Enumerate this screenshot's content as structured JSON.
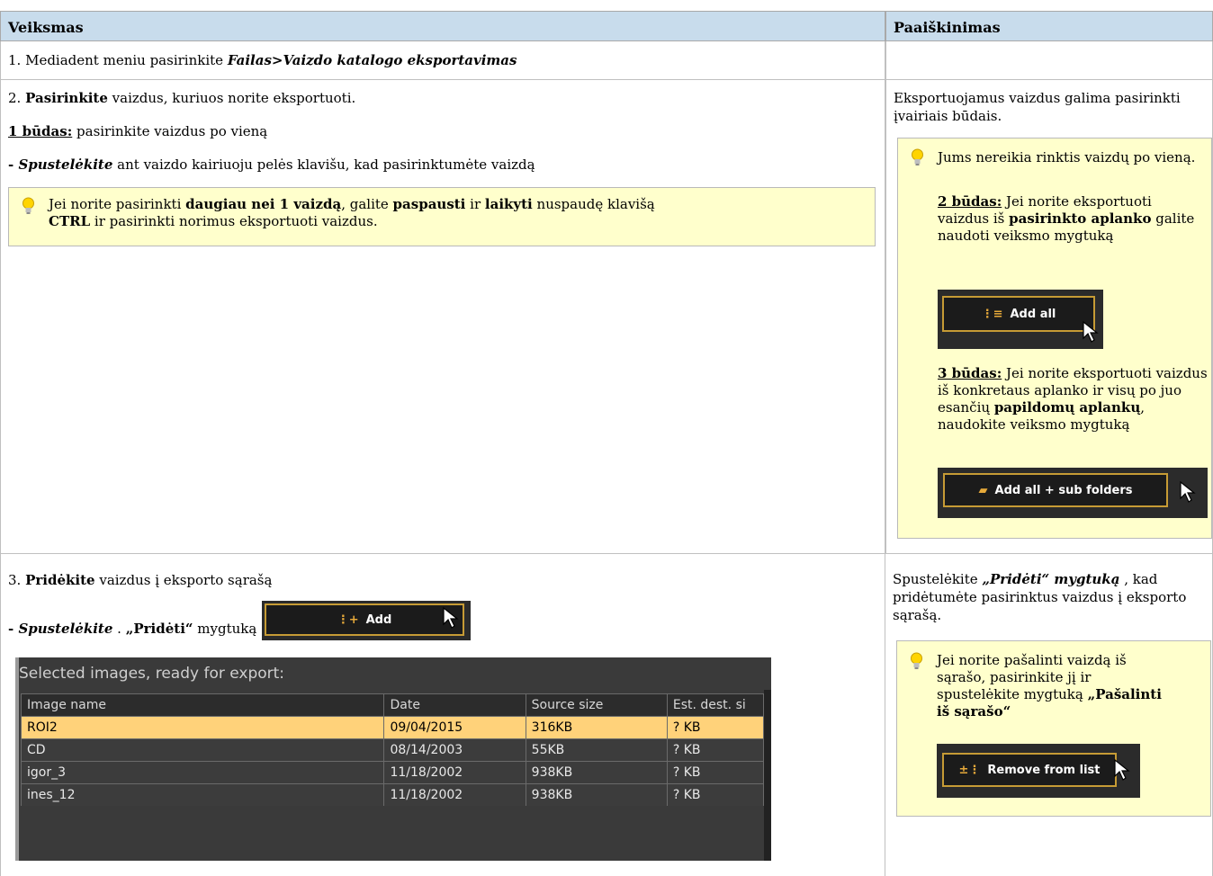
{
  "headers": {
    "action": "Veiksmas",
    "explanation": "Paaiškinimas"
  },
  "row1": {
    "prefix": "1. Mediadent meniu pasirinkite ",
    "menu_path": "Failas>Vaizdo katalogo eksportavimas"
  },
  "row2": {
    "step_num": "2. ",
    "step_bold": "Pasirinkite",
    "step_rest": " vaizdus, kuriuos norite eksportuoti.",
    "way1_label": "1 būdas:",
    "way1_rest": " pasirinkite vaizdus po vieną",
    "click_prefix": "- ",
    "click_bold": "Spustelėkite",
    "click_rest": " ant vaizdo kairiuoju pelės klavišu, kad pasirinktumėte vaizdą",
    "tip": {
      "t1": "Jei norite pasirinkti ",
      "b1": "daugiau nei 1 vaizdą",
      "t2": ", galite ",
      "b2": "paspausti",
      "t3": " ir ",
      "b3": "laikyti",
      "t4": " nuspaudę klavišą ",
      "b4": "CTRL",
      "t5": " ir pasirinkti norimus eksportuoti vaizdus."
    },
    "explanation": "Eksportuojamus vaizdus galima pasirinkti įvairiais būdais.",
    "side_tip": {
      "intro": "Jums nereikia rinktis vaizdų po vieną.",
      "way2_label": "2 būdas:",
      "way2_t1": " Jei norite eksportuoti vaizdus iš ",
      "way2_b1": "pasirinkto aplanko",
      "way2_t2": " galite naudoti veiksmo mygtuką",
      "add_all_label": "Add all",
      "way3_label": "3 būdas:",
      "way3_t1": " Jei norite eksportuoti vaizdus iš konkretaus aplanko ir visų po juo esančių ",
      "way3_b1": "papildomų aplankų",
      "way3_t2": ", naudokite veiksmo mygtuką",
      "add_all_sub_label": "Add all + sub folders"
    }
  },
  "row3": {
    "step_num": "3. ",
    "step_bold": "Pridėkite",
    "step_rest": " vaizdus į eksporto sąrašą",
    "click_prefix": "- ",
    "click_bold": "Spustelėkite",
    "click_mid": " . ",
    "click_bold2": "„Pridėti“",
    "click_rest": " mygtuką",
    "add_label": "Add",
    "panel_title": "Selected images, ready for export:",
    "columns": [
      "Image name",
      "Date",
      "Source size",
      "Est. dest. si"
    ],
    "rows": [
      [
        "ROI2",
        "09/04/2015",
        "316KB",
        "? KB"
      ],
      [
        "CD",
        "08/14/2003",
        "55KB",
        "? KB"
      ],
      [
        "igor_3",
        "11/18/2002",
        "938KB",
        "? KB"
      ],
      [
        "ines_12",
        "11/18/2002",
        "938KB",
        "? KB"
      ]
    ],
    "explanation": {
      "t1": "Spustelėkite ",
      "b1": "„Pridėti“ mygtuką",
      "t2": " , kad pridėtumėte pasirinktus vaizdus į eksporto sąrašą."
    },
    "side_tip": {
      "text": "Jei norite pašalinti vaizdą iš sąrašo, pasirinkite jį ir spustelėkite mygtuką ",
      "bold": "„Pašalinti iš sąrašo“",
      "remove_label": "Remove from list"
    }
  },
  "colors": {
    "header_bg": "#c8dcec",
    "tip_bg": "#ffffcc",
    "button_border": "#c69b35",
    "selected_row": "#ffd27a"
  }
}
